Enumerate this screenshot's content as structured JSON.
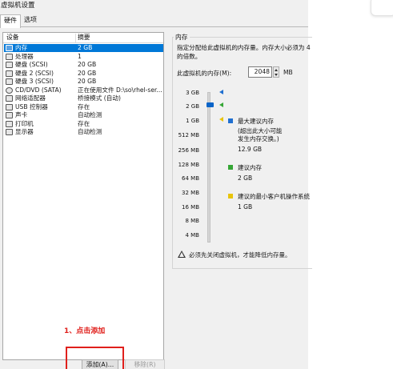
{
  "window": {
    "title": "虚拟机设置"
  },
  "tabs": [
    {
      "label": "硬件"
    },
    {
      "label": "选项"
    }
  ],
  "device_list": {
    "columns": {
      "device": "设备",
      "summary": "摘要"
    },
    "rows": [
      {
        "icon": "memory-icon",
        "name": "内存",
        "summary": "2 GB",
        "selected": true
      },
      {
        "icon": "cpu-icon",
        "name": "处理器",
        "summary": "1"
      },
      {
        "icon": "hard-disk-icon",
        "name": "硬盘 (SCSI)",
        "summary": "20 GB"
      },
      {
        "icon": "hard-disk-icon",
        "name": "硬盘 2 (SCSI)",
        "summary": "20 GB"
      },
      {
        "icon": "hard-disk-icon",
        "name": "硬盘 3 (SCSI)",
        "summary": "20 GB"
      },
      {
        "icon": "cd-dvd-icon",
        "name": "CD/DVD (SATA)",
        "summary": "正在使用文件 D:\\so\\rhel-ser..."
      },
      {
        "icon": "network-icon",
        "name": "网络适配器",
        "summary": "桥接模式 (自动)"
      },
      {
        "icon": "usb-icon",
        "name": "USB 控制器",
        "summary": "存在"
      },
      {
        "icon": "sound-icon",
        "name": "声卡",
        "summary": "自动检测"
      },
      {
        "icon": "printer-icon",
        "name": "打印机",
        "summary": "存在"
      },
      {
        "icon": "display-icon",
        "name": "显示器",
        "summary": "自动检测"
      }
    ],
    "add_button": "添加(A)...",
    "remove_button": "移除(R)"
  },
  "annotation": {
    "text": "1、点击添加",
    "color": "#e0201c"
  },
  "memory": {
    "group_title": "内存",
    "description_line1": "指定分配给此虚拟机的内存量。内存大小必须为 4",
    "description_line2": "的倍数。",
    "input_label": "此虚拟机的内存(M):",
    "input_value": "2048",
    "unit": "MB",
    "scale_labels": [
      "3 GB",
      "2 GB",
      "1 GB",
      "512 MB",
      "256 MB",
      "128 MB",
      "64 MB",
      "32 MB",
      "16 MB",
      "8 MB",
      "4 MB"
    ],
    "current_memory_gb": 2,
    "max_recommended": {
      "title": "最大建议内存",
      "note_line1": "(超出此大小可能",
      "note_line2": "发生内存交换。)",
      "value": "12.9 GB",
      "color": "#1f6fd0"
    },
    "recommended": {
      "title": "建议内存",
      "value": "2 GB",
      "color": "#35a635"
    },
    "min_guest": {
      "title": "建议的最小客户机操作系统",
      "value": "1 GB",
      "color": "#e8c40a"
    },
    "warning": "必须先关闭虚拟机，才能降低内存量。"
  }
}
